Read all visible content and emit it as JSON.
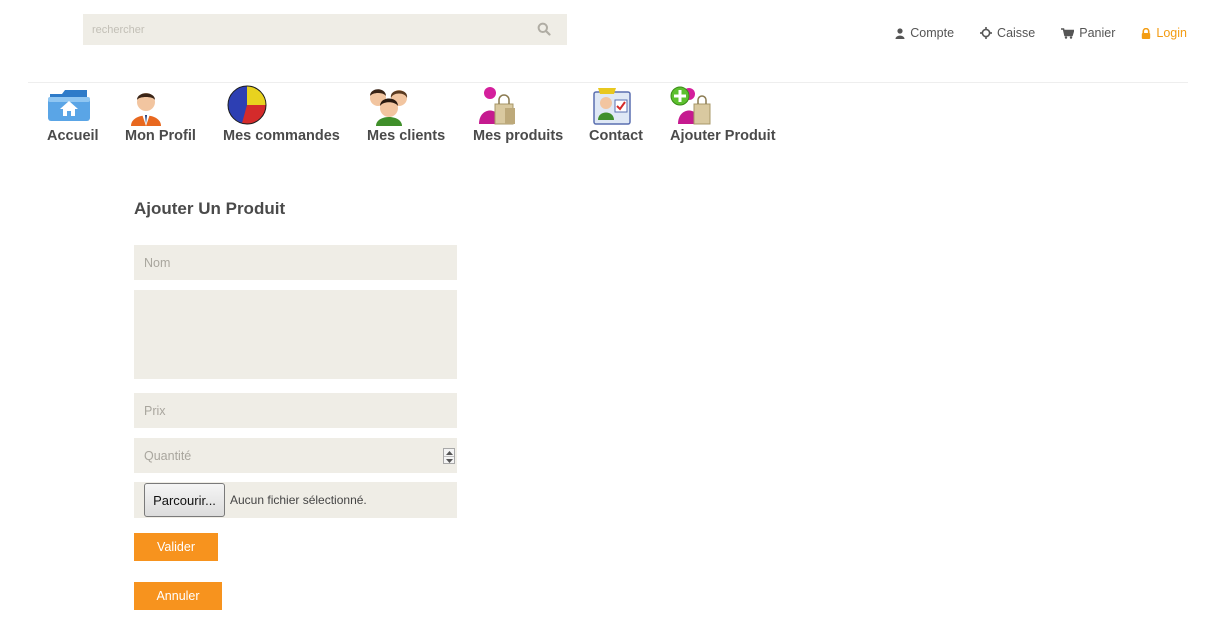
{
  "search": {
    "placeholder": "rechercher",
    "icon": "search-icon"
  },
  "top_links": [
    {
      "label": "Compte",
      "icon": "user-icon"
    },
    {
      "label": "Caisse",
      "icon": "crosshair-icon"
    },
    {
      "label": "Panier",
      "icon": "cart-icon"
    },
    {
      "label": "Login",
      "icon": "lock-icon"
    }
  ],
  "nav": [
    {
      "label": "Accueil",
      "icon": "home-folder-icon"
    },
    {
      "label": "Mon Profil",
      "icon": "user-profile-icon"
    },
    {
      "label": "Mes commandes",
      "icon": "pie-chart-icon"
    },
    {
      "label": "Mes clients",
      "icon": "group-icon"
    },
    {
      "label": "Mes produits",
      "icon": "shopping-bags-icon"
    },
    {
      "label": "Contact",
      "icon": "contact-card-icon"
    },
    {
      "label": "Ajouter Produit",
      "icon": "add-product-icon"
    }
  ],
  "form": {
    "title": "Ajouter Un Produit",
    "nom_placeholder": "Nom",
    "description_placeholder": "",
    "prix_placeholder": "Prix",
    "quantite_placeholder": "Quantité",
    "browse_label": "Parcourir...",
    "file_status": "Aucun fichier sélectionné.",
    "valider_label": "Valider",
    "annuler_label": "Annuler"
  },
  "colors": {
    "accent": "#f7931e",
    "field_bg": "#efede6",
    "login": "#f39c12"
  }
}
